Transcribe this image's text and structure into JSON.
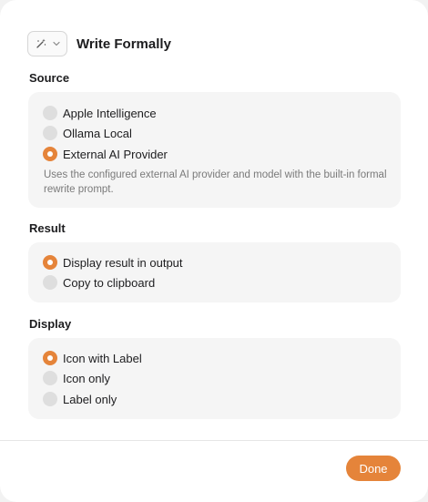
{
  "header": {
    "icon_picker": {
      "icon": "magic-wand-icon",
      "dropdown_icon": "chevron-down-icon"
    },
    "title": "Write Formally"
  },
  "source": {
    "label": "Source",
    "options": [
      {
        "label": "Apple Intelligence",
        "selected": false
      },
      {
        "label": "Ollama Local",
        "selected": false
      },
      {
        "label": "External AI Provider",
        "selected": true
      }
    ],
    "description": "Uses the configured external AI provider and model with the built-in formal rewrite prompt."
  },
  "result": {
    "label": "Result",
    "options": [
      {
        "label": "Display result in output",
        "selected": true
      },
      {
        "label": "Copy to clipboard",
        "selected": false
      }
    ]
  },
  "display": {
    "label": "Display",
    "options": [
      {
        "label": "Icon with Label",
        "selected": true
      },
      {
        "label": "Icon only",
        "selected": false
      },
      {
        "label": "Label only",
        "selected": false
      }
    ]
  },
  "footer": {
    "done_label": "Done"
  },
  "colors": {
    "accent": "#e5843a",
    "group_background": "#f5f5f5",
    "radio_off": "#dedede"
  }
}
